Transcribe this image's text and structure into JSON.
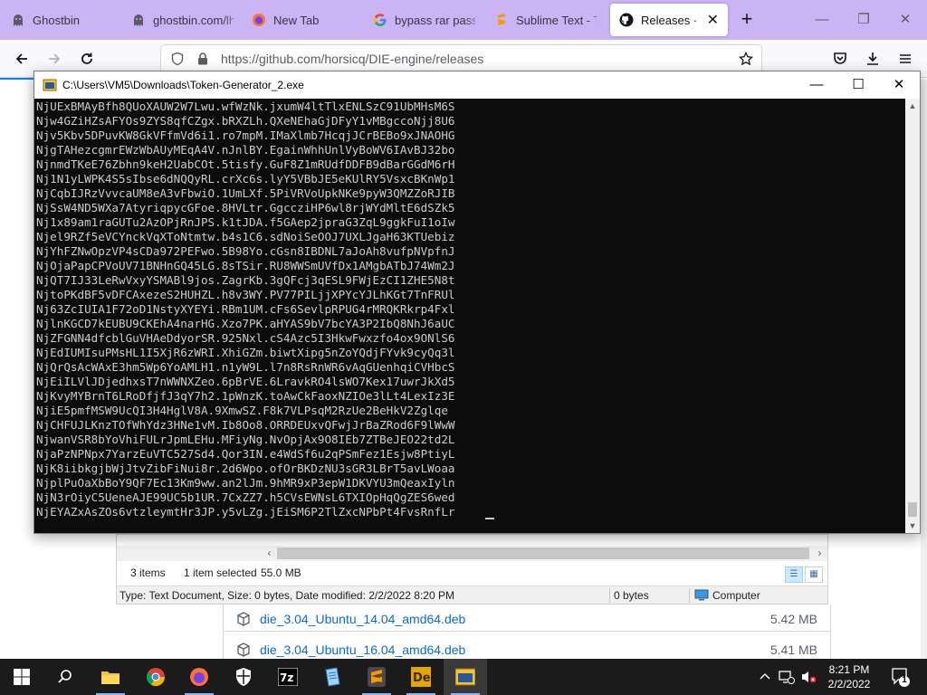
{
  "browser": {
    "tabs": [
      {
        "title": "Ghostbin",
        "icon": "ghost-icon",
        "active": false
      },
      {
        "title": "ghostbin.com/lh",
        "icon": "ghost-icon",
        "active": false
      },
      {
        "title": "New Tab",
        "icon": "firefox-icon",
        "active": false
      },
      {
        "title": "bypass rar passw",
        "icon": "google-icon",
        "active": false
      },
      {
        "title": "Sublime Text - Te",
        "icon": "sublime-icon",
        "active": false
      },
      {
        "title": "Releases · hors",
        "icon": "github-icon",
        "active": true
      }
    ],
    "new_tab_symbol": "+",
    "address": "https://github.com/horsicq/DIE-engine/releases",
    "window_controls": {
      "minimize": "—",
      "maximize": "❐",
      "close": "✕"
    }
  },
  "console": {
    "title": "C:\\Users\\VM5\\Downloads\\Token-Generator_2.exe",
    "lines": [
      "NjUExBMAyBfh8QUoXAUW2W7Lwu.wfWzNk.jxumW4ltTlxENLSzC91UbMHsM6S",
      "Njw4GZiHZsAFYOs9ZYS8qfCZgx.bRXZLh.QXeNEhaGjDFyY1vMBgccoNjj8U6",
      "Njv5Kbv5DPuvKW8GkVFfmVd6i1.ro7mpM.IMaXlmb7HcqjJCrBEBo9xJNAOHG",
      "NjgTAHezcgmrEWzWbAUyMEqA4V.nJnlBY.EgainWhhUnlVyBoWV6IAvBJ32bo",
      "NjnmdTKeE76Zbhn9keH2UabCOt.5tisfy.GuF8Z1mRUdfDDFB9dBarGGdM6rH",
      "Nj1N1yLWPK4S5sIbse6dNQQyRL.crXc6s.lyY5VBbJE5eKUlRY5VsxcBKnWp1",
      "NjCqbIJRzVvvcaUM8eA3vFbwiO.1UmLXf.5PiVRVoUpkNKe9pyW3QMZZoRJIB",
      "NjSsW4ND5WXa7AtyriqpycGFoe.8HVLtr.GgccziHP6wl8rjWYdMltE6dSZk5",
      "Nj1x89am1raGUTu2AzOPjRnJPS.k1tJDA.f5GAep2jpraG3ZqL9ggkFuI1oIw",
      "Njel9RZf5eVCYnckVqXToNtmtw.b4s1C6.sdNoiSeOOJ7UXLJgaH63KTUebiz",
      "NjYhFZNwOpzVP4sCDa972PEFwo.5B98Yo.cGsn8IBDNL7aJoAh8vufpNVpfnJ",
      "NjOjaPapCPVoUV71BNHnGQ45LG.8sTSir.RU8WWSmUVfDx1AMgbATbJ74Wm2J",
      "NjQT7IJ33LeRwVxyYSMABl9jos.ZagrKb.3gQFcj3qESL9FWjEzCI1ZHE5N8t",
      "NjtoPKdBF5vDFCAxezeS2HUHZL.h8v3WY.PV77PILjjXPYcYJLhKGt7TnFRUl",
      "Nj63ZcIUIA1F72oD1NstyXYEYi.RBm1UM.cFs6SevlpRPUG4rMRQKRkrp4Fxl",
      "NjlnKGCD7kEUBU9CKEhA4narHG.Xzo7PK.aHYAS9bV7bcYA3P2IbQ8NhJ6aUC",
      "NjZFGNN4dfcblGuVHAeDdyorSR.925Nxl.cS4Azc5I3HkwFwxzfo4ox9ONlS6",
      "NjEdIUMIsuPMsHL1I5XjR6zWRI.XhiGZm.biwtXipg5nZoYQdjFYvk9cyQq3l",
      "NjQrQsAcWAxE3hm5Wp6YoAMLH1.n1yW9L.l7n8RsRnWR6vAqGUenhqiCVHbcS",
      "NjEiILVlJDjedhxsT7nWWNXZeo.6pBrVE.6LravkRO4lsWO7Kex17uwrJkXd5",
      "NjKvyMYBrnT6LRoDfjfJ3qY7h2.1pWnzK.toAwCkFaoxNZIOe3lLt4LexIz3E",
      "NjiE5pmfMSW9UcQI3H4HglV8A.9XmwSZ.F8k7VLPsqM2RzUe2BeHkV2Zglqe",
      "NjCHFUJLKnzTOfWhYdz3HNe1vM.Ib8Oo8.ORRDEUxvQFwjJrBaZRod6F9lWwW",
      "NjwanVSR8bYoVhiFULrJpmLEHu.MFiyNg.NvOpjAx9O8IEb7ZTBeJEO22td2L",
      "NjaPzNPNpx7YarzEuVTC527Sd4.Qor3IN.e4WdSf6u2qPSmFez1Esjw8PtiyL",
      "NjK8iibkgjbWjJtvZibFiNui8r.2d6Wpo.ofOrBKDzNU3sGR3LBrT5avLWoaa",
      "NjplPuOaXbBoY9QF7Ec13Km9ww.an2lJm.9hMR9xP3epW1DKVYU3mQeaxIyln",
      "NjN3rOiyC5UeneAJE99UC5b1UR.7CxZZ7.h5CVsEWNsL6TXIOpHqQgZES6wed",
      "NjEYAZxAsZOs6vtzleymtHr3JP.y5vLZg.jEiSM6P2TlZxcNPbPt4FvsRnfLr"
    ]
  },
  "explorer": {
    "item_count": "3 items",
    "selection": "1 item selected",
    "selection_size": "55.0 MB",
    "status_details": "Type: Text Document, Size: 0 bytes, Date modified: 2/2/2022 8:20 PM",
    "status_size": "0 bytes",
    "status_location": "Computer"
  },
  "github": {
    "assets": [
      {
        "name": "die_3.04_Ubuntu_14.04_amd64.deb",
        "size": "5.42 MB"
      },
      {
        "name": "die_3.04_Ubuntu_16.04_amd64.deb",
        "size": "5.41 MB"
      }
    ]
  },
  "taskbar": {
    "apps": [
      "windows-start-icon",
      "search-icon",
      "file-explorer-icon",
      "chrome-icon",
      "firefox-icon",
      "security-shield-icon",
      "7zip-icon",
      "notepad-icon",
      "sublime-text-icon",
      "detect-it-easy-icon",
      "token-generator-icon"
    ],
    "time": "8:21 PM",
    "date": "2/2/2022",
    "notification_count": "1"
  },
  "colors": {
    "tabstrip": "#cbb4f4",
    "console_bg": "#0c0c0c",
    "console_text": "#cccccc",
    "taskbar": "#1b1b1b",
    "link": "#0969da"
  }
}
